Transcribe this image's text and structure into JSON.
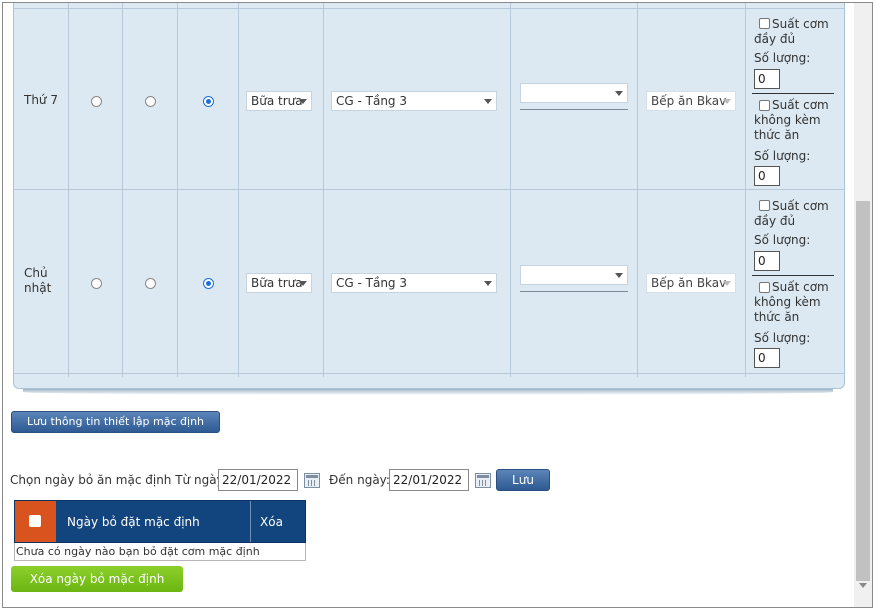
{
  "rows": [
    {
      "day": "Thứ 7",
      "meal": "Bữa trưa",
      "location": "CG - Tầng 3",
      "extra": "",
      "kitchen": "Bếp ăn Bkav",
      "full_label": "Suất cơm đầy đủ",
      "qty_label": "Số lượng:",
      "qty_full": "0",
      "nofood_label": "Suất cơm không kèm thức ăn",
      "qty_nofood": "0"
    },
    {
      "day": "Chủ nhật",
      "meal": "Bữa trưa",
      "location": "CG - Tầng 3",
      "extra": "",
      "kitchen": "Bếp ăn Bkav",
      "full_label": "Suất cơm đầy đủ",
      "qty_label": "Số lượng:",
      "qty_full": "0",
      "nofood_label": "Suất cơm không kèm thức ăn",
      "qty_nofood": "0"
    }
  ],
  "save_default_button": "Lưu thông tin thiết lập mặc định",
  "date_filter": {
    "prefix": "Chọn ngày bỏ ăn mặc định Từ ngày:",
    "from": "22/01/2022",
    "to_label": "Đến ngày:",
    "to": "22/01/2022",
    "save": "Lưu"
  },
  "grid": {
    "col_date": "Ngày bỏ đặt mặc định",
    "col_delete": "Xóa",
    "empty": "Chưa có ngày nào bạn bỏ đặt cơm mặc định"
  },
  "delete_button": "Xóa ngày bỏ mặc định",
  "colors": {
    "header": "#12457e",
    "accent_orange": "#d9531e",
    "green": "#7cc21f",
    "table_bg": "#dce9f2"
  }
}
